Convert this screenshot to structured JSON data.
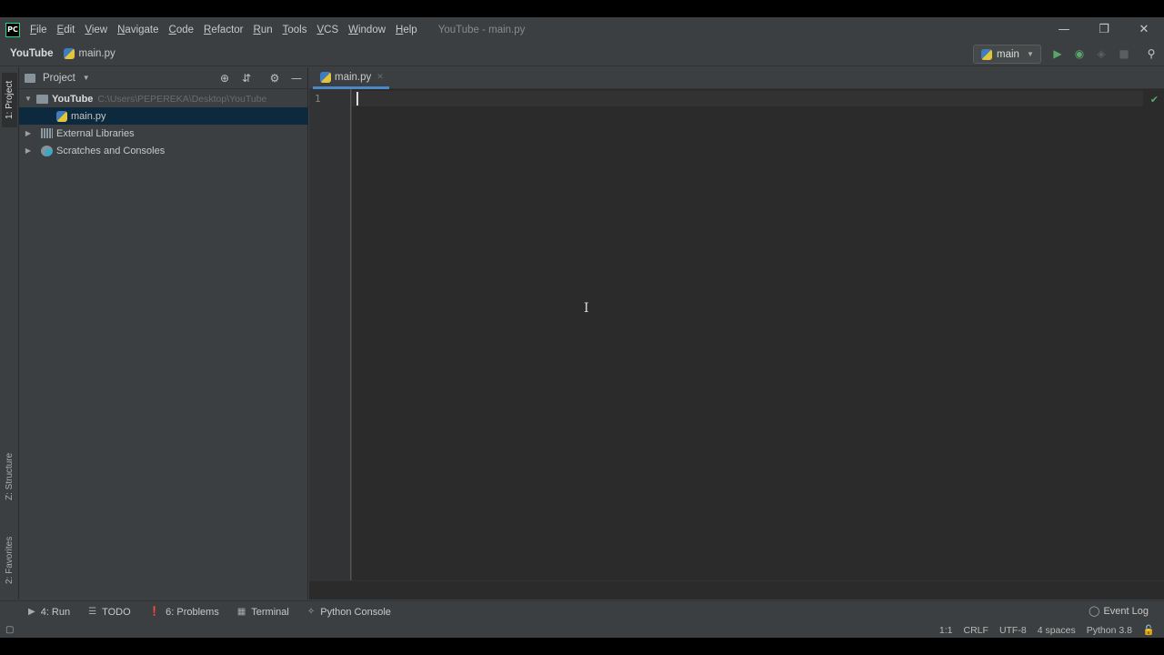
{
  "menubar": {
    "items": [
      "File",
      "Edit",
      "View",
      "Navigate",
      "Code",
      "Refactor",
      "Run",
      "Tools",
      "VCS",
      "Window",
      "Help"
    ],
    "window_title": "YouTube - main.py",
    "logo": "PC"
  },
  "navbar": {
    "project": "YouTube",
    "file": "main.py",
    "run_config": "main"
  },
  "left_strip": {
    "project_tab": "1: Project",
    "structure_tab": "Z: Structure",
    "favorites_tab": "2: Favorites"
  },
  "project_panel": {
    "title": "Project",
    "tree": {
      "root_name": "YouTube",
      "root_path": "C:\\Users\\PEPEREKA\\Desktop\\YouTube",
      "file": "main.py",
      "external_libraries": "External Libraries",
      "scratches": "Scratches and Consoles"
    }
  },
  "editor": {
    "tab_label": "main.py",
    "line_numbers": [
      "1"
    ]
  },
  "bottom_tools": {
    "run": "4: Run",
    "todo": "TODO",
    "problems": "6: Problems",
    "terminal": "Terminal",
    "python_console": "Python Console",
    "event_log": "Event Log"
  },
  "status_bar": {
    "position": "1:1",
    "line_separator": "CRLF",
    "encoding": "UTF-8",
    "indent": "4 spaces",
    "interpreter": "Python 3.8"
  },
  "colors": {
    "accent": "#4a88c7",
    "run_green": "#59a869",
    "selection": "#0d293e"
  }
}
